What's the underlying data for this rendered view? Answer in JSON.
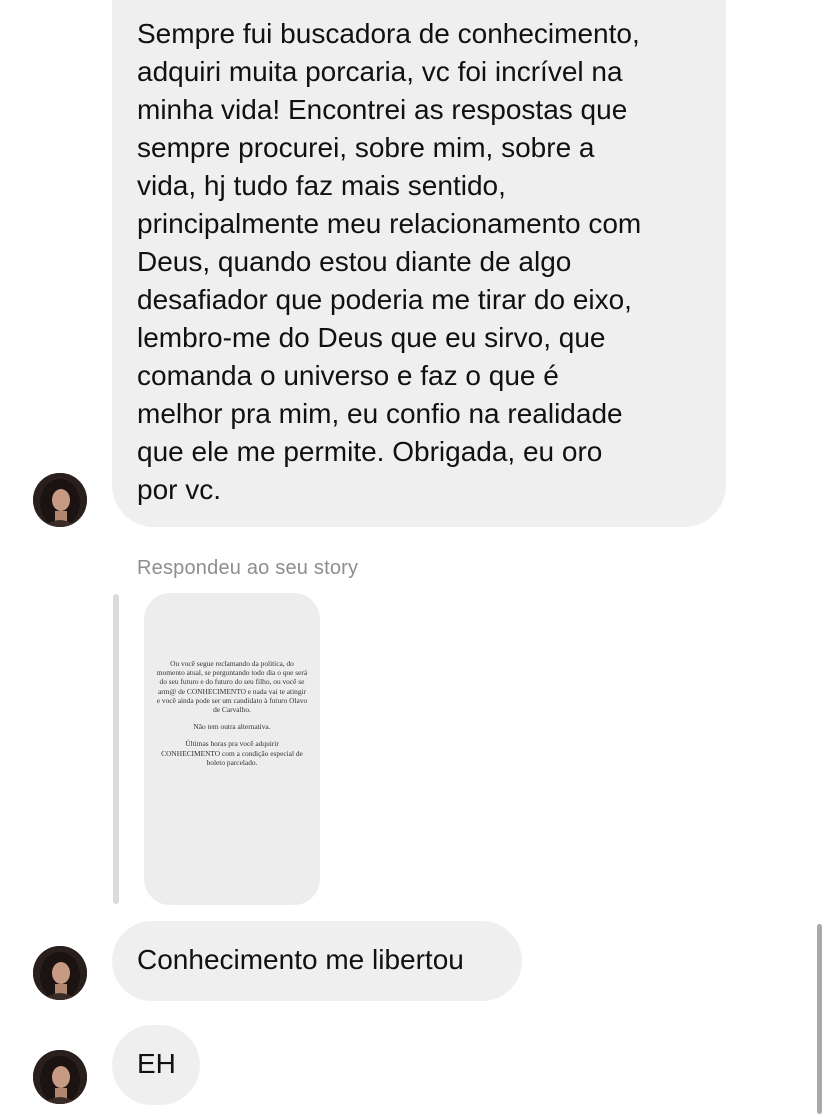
{
  "thread": {
    "messages": [
      {
        "text": "Sempre fui buscadora de conhecimento,\nadquiri muita porcaria, vc foi incrível na\nminha vida! Encontrei as respostas que\nsempre procurei, sobre mim, sobre a\nvida, hj tudo faz mais sentido,\nprincipalmente meu relacionamento com\nDeus, quando estou diante de algo\ndesafiador que poderia me tirar do eixo,\nlembro-me do Deus que eu sirvo, que\ncomanda o universo e faz o que é\nmelhor pra mim, eu confio na realidade\nque ele me permite. Obrigada, eu oro\npor vc."
      },
      {
        "text": "Conhecimento me libertou"
      },
      {
        "text": "EH"
      }
    ],
    "story_reply": {
      "label": "Respondeu ao seu story",
      "story_text": {
        "p1": "Ou você segue reclamando da politica, do momento atual, se perguntando todo dia o que será do seu futuro e do futuro do seu filho, ou você se arm@ de CONHECIMENTO e nada vai te atingir e você ainda pode ser um candidato à futuro Olavo de Carvalho.",
        "p2": "Não tem outra alternativa.",
        "p3": "Últimas horas pra você adquirir CONHECIMENTO com a condição especial de boleto parcelado."
      }
    }
  },
  "colors": {
    "bubble": "#efefef",
    "label": "#8e8e8e",
    "reply_bar": "#dbdbdb"
  },
  "icons": {
    "avatar": "user-avatar-photo"
  }
}
